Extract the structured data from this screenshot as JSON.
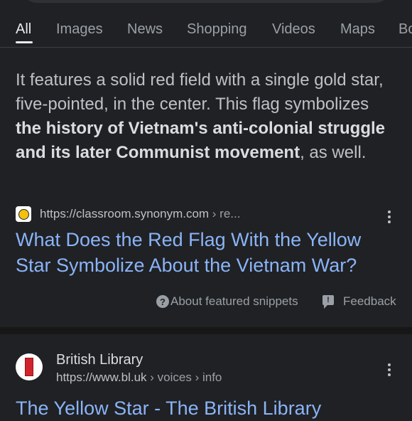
{
  "tabs": [
    {
      "label": "All",
      "active": true
    },
    {
      "label": "Images"
    },
    {
      "label": "News"
    },
    {
      "label": "Shopping"
    },
    {
      "label": "Videos"
    },
    {
      "label": "Maps"
    },
    {
      "label": "Bo"
    }
  ],
  "snippet": {
    "text_part1": "It features a solid red field with a single gold star, five-pointed, in the center. This flag symbolizes ",
    "bold_part": "the history of Vietnam's anti-colonial struggle and its later Communist movement",
    "text_part2": ", as well."
  },
  "featured_result": {
    "url": "https://classroom.synonym.com",
    "breadcrumb": " › re...",
    "title_line1": "What Does the Red Flag With the Yellow",
    "title_line2": "Star Symbolize About the Vietnam War?",
    "favicon": "yellow-circle-icon"
  },
  "footer": {
    "about_icon": "?",
    "about_label": "About featured snippets",
    "feedback_label": "Feedback",
    "feedback_icon": "!"
  },
  "second_result": {
    "site_name": "British Library",
    "url": "https://www.bl.uk",
    "breadcrumb": " › voices › info",
    "title": "The Yellow Star - The British Library",
    "favicon": "british-library-icon"
  },
  "colors": {
    "background": "#202124",
    "link": "#8ab4f8",
    "text": "#bdc1c6"
  }
}
